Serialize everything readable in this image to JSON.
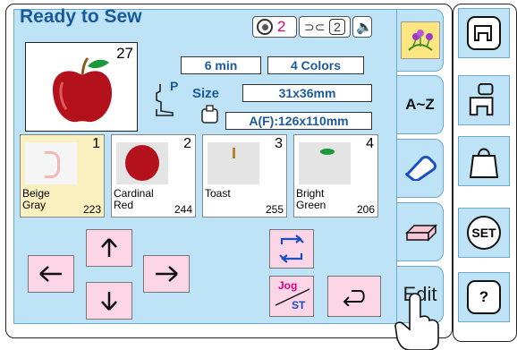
{
  "header": {
    "title": "Ready to Sew",
    "spool_count": "2",
    "bobbin_count": "2"
  },
  "design": {
    "stitch_number": "27",
    "time": "6 min",
    "colors": "4 Colors",
    "size_label": "Size",
    "size": "31x36mm",
    "presser_label": "P",
    "hoop": "A(F):126x110mm"
  },
  "threads": [
    {
      "index": "1",
      "name": "Beige Gray",
      "code": "223",
      "selected": true,
      "swatch": "#f4c9c9"
    },
    {
      "index": "2",
      "name": "Cardinal Red",
      "code": "244",
      "selected": false,
      "swatch": "#b3121c"
    },
    {
      "index": "3",
      "name": "Toast",
      "code": "255",
      "selected": false,
      "swatch": "#b8832a"
    },
    {
      "index": "4",
      "name": "Bright Green",
      "code": "206",
      "selected": false,
      "swatch": "#1a9a3b"
    }
  ],
  "controls": {
    "jog_top": "Jog",
    "jog_bottom": "ST"
  },
  "tabs": {
    "font_tab": "A~Z",
    "edit_tab": "Edit"
  },
  "sidebar": {
    "set_label": "SET",
    "help_label": "?"
  }
}
